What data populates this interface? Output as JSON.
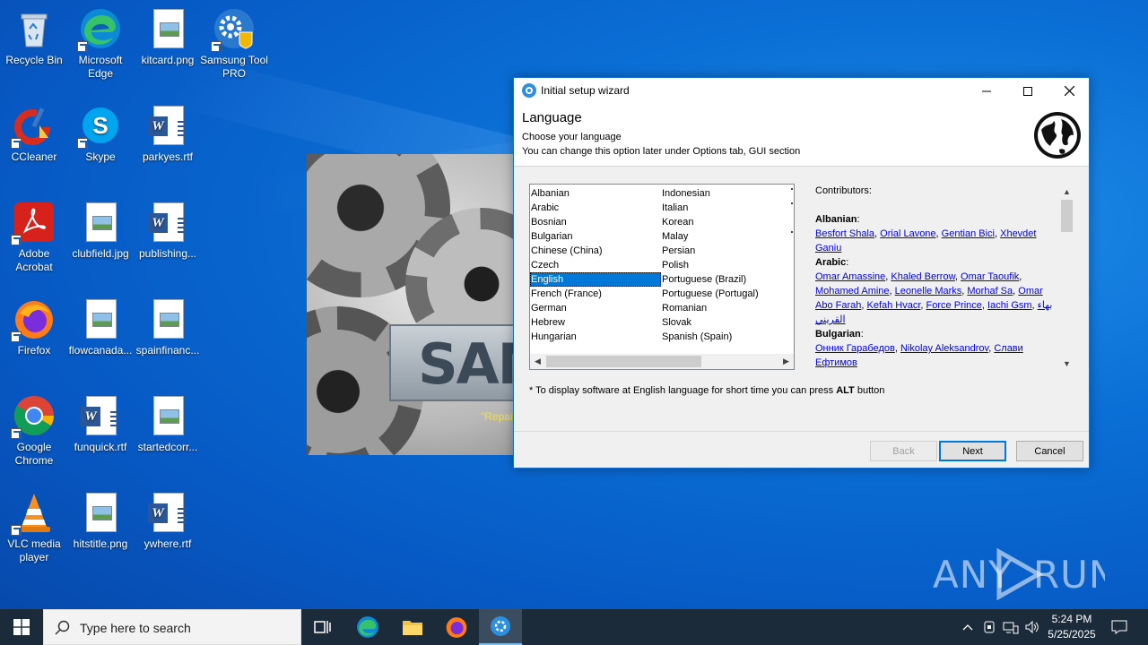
{
  "desktop": {
    "icons": [
      {
        "label": "Recycle Bin"
      },
      {
        "label": "Microsoft Edge"
      },
      {
        "label": "kitcard.png"
      },
      {
        "label": "Samsung Tool PRO"
      },
      {
        "label": "CCleaner"
      },
      {
        "label": "Skype"
      },
      {
        "label": "parkyes.rtf"
      },
      {
        "label": "Adobe Acrobat"
      },
      {
        "label": "clubfield.jpg"
      },
      {
        "label": "publishing..."
      },
      {
        "label": "Firefox"
      },
      {
        "label": "flowcanada..."
      },
      {
        "label": "spainfinanc..."
      },
      {
        "label": "Google Chrome"
      },
      {
        "label": "funquick.rtf"
      },
      {
        "label": "startedcorr..."
      },
      {
        "label": "VLC media player"
      },
      {
        "label": "hitstitle.png"
      },
      {
        "label": "ywhere.rtf"
      }
    ]
  },
  "splash": {
    "banner_text": "SAM",
    "repair_text": "\"Repai"
  },
  "wizard": {
    "title": "Initial setup wizard",
    "heading": "Language",
    "subtitle": "Choose your language",
    "hint": "You can change this option later under Options tab, GUI section",
    "languages_col1": [
      "Albanian",
      "Arabic",
      "Bosnian",
      "Bulgarian",
      "Chinese (China)",
      "Czech",
      "English",
      "French (France)",
      "German",
      "Hebrew",
      "Hungarian"
    ],
    "languages_col2": [
      "Indonesian",
      "Italian",
      "Korean",
      "Malay",
      "Persian",
      "Polish",
      "Portuguese (Brazil)",
      "Portuguese (Portugal)",
      "Romanian",
      "Slovak",
      "Spanish (Spain)"
    ],
    "selected_language": "English",
    "contributors": {
      "heading": "Contributors:",
      "albanian_label": "Albanian",
      "albanian": [
        "Besfort Shala",
        "Orial Lavone",
        "Gentian Bici",
        "Xhevdet Ganiu"
      ],
      "arabic_label": "Arabic",
      "arabic": [
        "Omar Amassine",
        "Khaled Berrow",
        "Omar Taoufik",
        "Mohamed Amine",
        "Leonelle Marks",
        "Morhaf Sa",
        "Omar Abo Farah",
        "Kefah Hvacr",
        "Force Prince",
        "Iachi Gsm",
        "بهاء القريني"
      ],
      "bulgarian_label": "Bulgarian",
      "bulgarian": [
        "Онник Гарабедов",
        "Nikolay Aleksandrov",
        "Слави Ефтимов"
      ]
    },
    "note_prefix": "* To display software at English language for short time you can press ",
    "note_key": "ALT",
    "note_suffix": " button",
    "buttons": {
      "back": "Back",
      "next": "Next",
      "cancel": "Cancel"
    }
  },
  "watermark": "ANY RUN",
  "taskbar": {
    "search_placeholder": "Type here to search",
    "time": "5:24 PM",
    "date": "5/25/2025"
  }
}
